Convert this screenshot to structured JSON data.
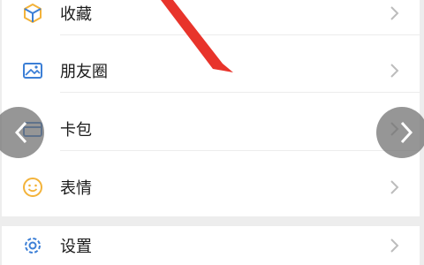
{
  "menu": {
    "group1": [
      {
        "label": "收藏",
        "icon": "favorites-cube-icon"
      },
      {
        "label": "朋友圈",
        "icon": "moments-image-icon"
      },
      {
        "label": "卡包",
        "icon": "card-wallet-icon"
      },
      {
        "label": "表情",
        "icon": "smiley-face-icon"
      }
    ],
    "group2": [
      {
        "label": "设置",
        "icon": "settings-gear-icon"
      }
    ]
  },
  "overlay": {
    "prev": "chevron-left-icon",
    "next": "chevron-right-icon",
    "annotation": "red-arrow-pointer"
  },
  "colors": {
    "background": "#ededed",
    "row": "#ffffff",
    "arrow": "#e8342b",
    "icon_yellow": "#f3b33a",
    "icon_blue": "#3c7fd6",
    "chevron": "#bcbcbc"
  }
}
